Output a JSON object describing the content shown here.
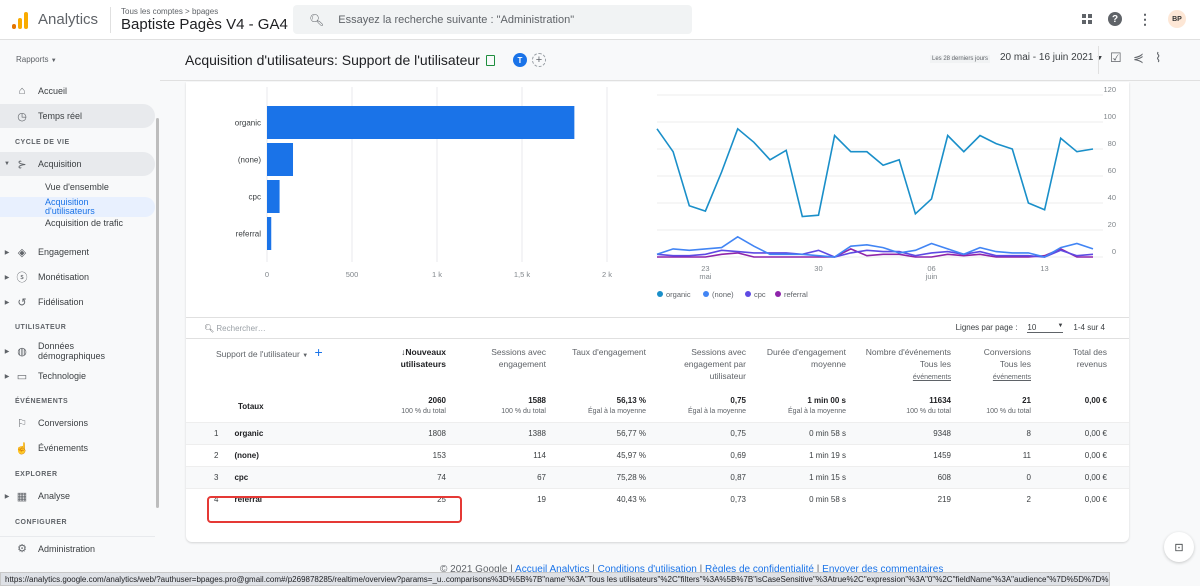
{
  "topbar": {
    "app_name": "Analytics",
    "breadcrumb": "Tous les comptes > bpages",
    "property": "Baptiste Pagès V4  - GA4",
    "search_placeholder": "Essayez la recherche suivante : \"Administration\"",
    "avatar_initials": "BP"
  },
  "sidebar": {
    "reports_label": "Rapports",
    "items": [
      {
        "label": "Accueil",
        "icon": "home-icon"
      },
      {
        "label": "Temps réel",
        "icon": "clock-icon"
      }
    ],
    "sections": {
      "lifecycle": "CYCLE DE VIE",
      "user": "UTILISATEUR",
      "events": "ÉVÉNEMENTS",
      "explore": "EXPLORER",
      "configure": "CONFIGURER"
    },
    "acquisition": {
      "label": "Acquisition",
      "sub": [
        "Vue d'ensemble",
        "Acquisition d'utilisateurs",
        "Acquisition de trafic"
      ]
    },
    "engagement": "Engagement",
    "monetisation": "Monétisation",
    "fidelisation": "Fidélisation",
    "demographics": "Données démographiques",
    "technology": "Technologie",
    "conversions": "Conversions",
    "events_item": "Événements",
    "analysis": "Analyse",
    "admin": "Administration"
  },
  "header": {
    "title": "Acquisition d'utilisateurs: Support de l'utilisateur",
    "comparison_badge": "T",
    "range_label": "Les 28 derniers jours",
    "date_range": "20 mai - 16 juin 2021"
  },
  "chart_data": [
    {
      "type": "bar",
      "orientation": "horizontal",
      "categories": [
        "organic",
        "(none)",
        "cpc",
        "referral"
      ],
      "values": [
        1808,
        153,
        74,
        25
      ],
      "xlim": [
        0,
        2000
      ],
      "xticks": [
        "0",
        "500",
        "1 k",
        "1,5 k",
        "2 k"
      ],
      "color": "#1a73e8"
    },
    {
      "type": "line",
      "x_labels": [
        {
          "day": "23",
          "month": "mai",
          "index": 3
        },
        {
          "day": "30",
          "month": "",
          "index": 10
        },
        {
          "day": "06",
          "month": "juin",
          "index": 17
        },
        {
          "day": "13",
          "month": "",
          "index": 24
        }
      ],
      "ylim": [
        0,
        120
      ],
      "yticks": [
        0,
        20,
        40,
        60,
        80,
        100,
        120
      ],
      "legend": "bottom-left",
      "series": [
        {
          "name": "organic",
          "color": "#1a8fc9",
          "values": [
            95,
            78,
            38,
            34,
            63,
            95,
            85,
            72,
            79,
            30,
            31,
            90,
            78,
            78,
            68,
            72,
            32,
            43,
            90,
            78,
            90,
            84,
            80,
            40,
            35,
            88,
            78,
            80
          ]
        },
        {
          "name": "(none)",
          "color": "#4285f4",
          "values": [
            2,
            6,
            5,
            6,
            7,
            15,
            8,
            2,
            2,
            2,
            1,
            0,
            8,
            9,
            7,
            3,
            5,
            10,
            6,
            2,
            7,
            4,
            3,
            3,
            0,
            7,
            10,
            6
          ]
        },
        {
          "name": "cpc",
          "color": "#5e4ae3",
          "values": [
            2,
            1,
            1,
            2,
            5,
            4,
            3,
            3,
            3,
            2,
            5,
            0,
            3,
            5,
            4,
            4,
            1,
            3,
            4,
            2,
            4,
            1,
            1,
            1,
            0,
            5,
            1,
            2
          ]
        },
        {
          "name": "referral",
          "color": "#8e24aa",
          "values": [
            0,
            0,
            0,
            0,
            2,
            3,
            0,
            0,
            0,
            0,
            0,
            0,
            6,
            1,
            2,
            2,
            0,
            0,
            2,
            1,
            2,
            0,
            0,
            0,
            1,
            6,
            0,
            0
          ]
        }
      ]
    }
  ],
  "table": {
    "search_placeholder": "Rechercher…",
    "rows_per_page_label": "Lignes par page :",
    "rows_per_page": "10",
    "pagination": "1-4 sur 4",
    "columns": [
      "Support de l'utilisateur",
      "↓Nouveaux utilisateurs",
      "Sessions avec engagement",
      "Taux d'engagement",
      "Sessions avec engagement par utilisateur",
      "Durée d'engagement moyenne",
      "Nombre d'événements",
      "Conversions",
      "Total des revenus"
    ],
    "col_sub": {
      "events": "Tous les",
      "events_link": "événements",
      "conv": "Tous les",
      "conv_link": "événements"
    },
    "totals": {
      "label": "Totaux",
      "values": [
        "2060",
        "1588",
        "56,13 %",
        "0,75",
        "1 min 00 s",
        "11634",
        "21",
        "0,00 €"
      ],
      "subs": [
        "100 % du total",
        "100 % du total",
        "Égal à la moyenne",
        "Égal à la moyenne",
        "Égal à la moyenne",
        "100 % du total",
        "100 % du total",
        ""
      ]
    },
    "rows": [
      {
        "idx": "1",
        "dim": "organic",
        "values": [
          "1808",
          "1388",
          "56,77 %",
          "0,75",
          "0 min 58 s",
          "9348",
          "8",
          "0,00 €"
        ]
      },
      {
        "idx": "2",
        "dim": "(none)",
        "values": [
          "153",
          "114",
          "45,97 %",
          "0,69",
          "1 min 19 s",
          "1459",
          "11",
          "0,00 €"
        ]
      },
      {
        "idx": "3",
        "dim": "cpc",
        "values": [
          "74",
          "67",
          "75,28 %",
          "0,87",
          "1 min 15 s",
          "608",
          "0",
          "0,00 €"
        ]
      },
      {
        "idx": "4",
        "dim": "referral",
        "values": [
          "25",
          "19",
          "40,43 %",
          "0,73",
          "0 min 58 s",
          "219",
          "2",
          "0,00 €"
        ]
      }
    ]
  },
  "footer": {
    "copyright": "© 2021 Google | ",
    "links": [
      "Accueil Analytics",
      "Conditions d'utilisation",
      "Règles de confidentialité",
      "Envoyer des commentaires"
    ]
  },
  "statusbar": "https://analytics.google.com/analytics/web/?authuser=bpages.pro@gmail.com#/p269878285/realtime/overview?params=_u..comparisons%3D%5B%7B\"name\"%3A\"Tous les utilisateurs\"%2C\"filters\"%3A%5B%7B\"isCaseSensitive\"%3Atrue%2C\"expression\"%3A\"0\"%2C\"fieldName\"%3A\"audience\"%7D%5D%7D%5D%26_u..pageSize%3D25"
}
